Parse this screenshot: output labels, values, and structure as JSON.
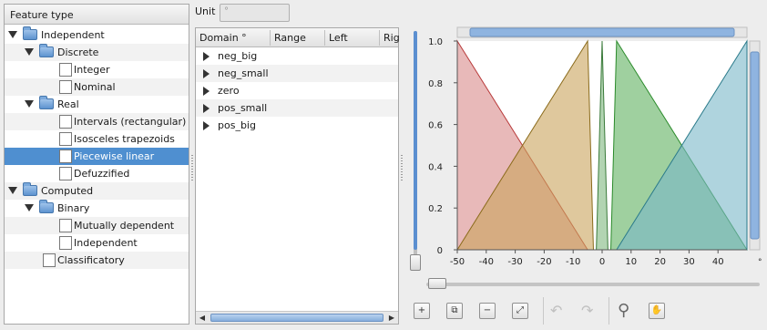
{
  "tree": {
    "header": "Feature type",
    "items": [
      {
        "label": "Independent",
        "level": 0,
        "kind": "folder",
        "icon": "folder-icon"
      },
      {
        "label": "Discrete",
        "level": 1,
        "kind": "folder",
        "icon": "folder-icon"
      },
      {
        "label": "Integer",
        "level": 2,
        "kind": "leaf",
        "icon": "integer-icon"
      },
      {
        "label": "Nominal",
        "level": 2,
        "kind": "leaf",
        "icon": "nominal-icon"
      },
      {
        "label": "Real",
        "level": 1,
        "kind": "folder",
        "icon": "folder-icon"
      },
      {
        "label": "Intervals (rectangular)",
        "level": 2,
        "kind": "leaf",
        "icon": "intervals-icon"
      },
      {
        "label": "Isosceles trapezoids",
        "level": 2,
        "kind": "leaf",
        "icon": "trapezoid-icon"
      },
      {
        "label": "Piecewise linear",
        "level": 2,
        "kind": "leaf",
        "icon": "piecewise-linear-icon",
        "selected": true
      },
      {
        "label": "Defuzzified",
        "level": 2,
        "kind": "leaf",
        "icon": "defuzzified-icon"
      },
      {
        "label": "Computed",
        "level": 0,
        "kind": "folder",
        "icon": "folder-icon"
      },
      {
        "label": "Binary",
        "level": 1,
        "kind": "folder",
        "icon": "folder-icon"
      },
      {
        "label": "Mutually dependent",
        "level": 2,
        "kind": "leaf",
        "icon": "mutually-dependent-icon"
      },
      {
        "label": "Independent",
        "level": 2,
        "kind": "leaf",
        "icon": "binary-independent-icon"
      },
      {
        "label": "Classificatory",
        "level": 1,
        "kind": "leaf",
        "icon": "classificatory-icon"
      }
    ]
  },
  "unit": {
    "label": "Unit",
    "value": "°"
  },
  "table": {
    "columns": [
      "Domain °",
      "Range",
      "Left",
      "Rig"
    ],
    "rows": [
      "neg_big",
      "neg_small",
      "zero",
      "pos_small",
      "pos_big"
    ]
  },
  "chart_data": {
    "type": "area",
    "xlim": [
      -50,
      50
    ],
    "ylim": [
      0,
      1
    ],
    "xticks": [
      "-50",
      "-40",
      "-30",
      "-20",
      "-10",
      "0",
      "10",
      "20",
      "30",
      "40"
    ],
    "yticks": [
      "1.0",
      "0.8",
      "0.6",
      "0.4",
      "0.2",
      "0"
    ],
    "x_unit": "°",
    "grid": false,
    "series": [
      {
        "name": "neg_big",
        "points": [
          [
            -50,
            1
          ],
          [
            -5,
            0
          ]
        ],
        "color": "#d98a8a",
        "stroke": "#b83a3a"
      },
      {
        "name": "neg_small",
        "points": [
          [
            -50,
            0
          ],
          [
            -5,
            1
          ],
          [
            -3,
            0
          ]
        ],
        "color": "#c9a35c",
        "stroke": "#8a6a1a"
      },
      {
        "name": "zero",
        "points": [
          [
            -2,
            0
          ],
          [
            0,
            1
          ],
          [
            2,
            0
          ]
        ],
        "color": "#7fb87f",
        "stroke": "#3a7a3a"
      },
      {
        "name": "pos_small",
        "points": [
          [
            3,
            0
          ],
          [
            5,
            1
          ],
          [
            50,
            0
          ]
        ],
        "color": "#5fb05f",
        "stroke": "#2a8a2a"
      },
      {
        "name": "pos_big",
        "points": [
          [
            5,
            0
          ],
          [
            50,
            1
          ]
        ],
        "color": "#7ab8c8",
        "stroke": "#2a7a8a"
      }
    ]
  },
  "toolbar": {
    "buttons": [
      {
        "name": "add-button",
        "glyph": "+"
      },
      {
        "name": "copy-button",
        "glyph": "⧉"
      },
      {
        "name": "remove-button",
        "glyph": "−"
      },
      {
        "name": "fit-button",
        "glyph": "⤢"
      },
      {
        "name": "undo-button",
        "glyph": "↶"
      },
      {
        "name": "redo-button",
        "glyph": "↷"
      },
      {
        "name": "zoom-button",
        "glyph": "⚲"
      },
      {
        "name": "pan-button",
        "glyph": "✋"
      }
    ]
  }
}
